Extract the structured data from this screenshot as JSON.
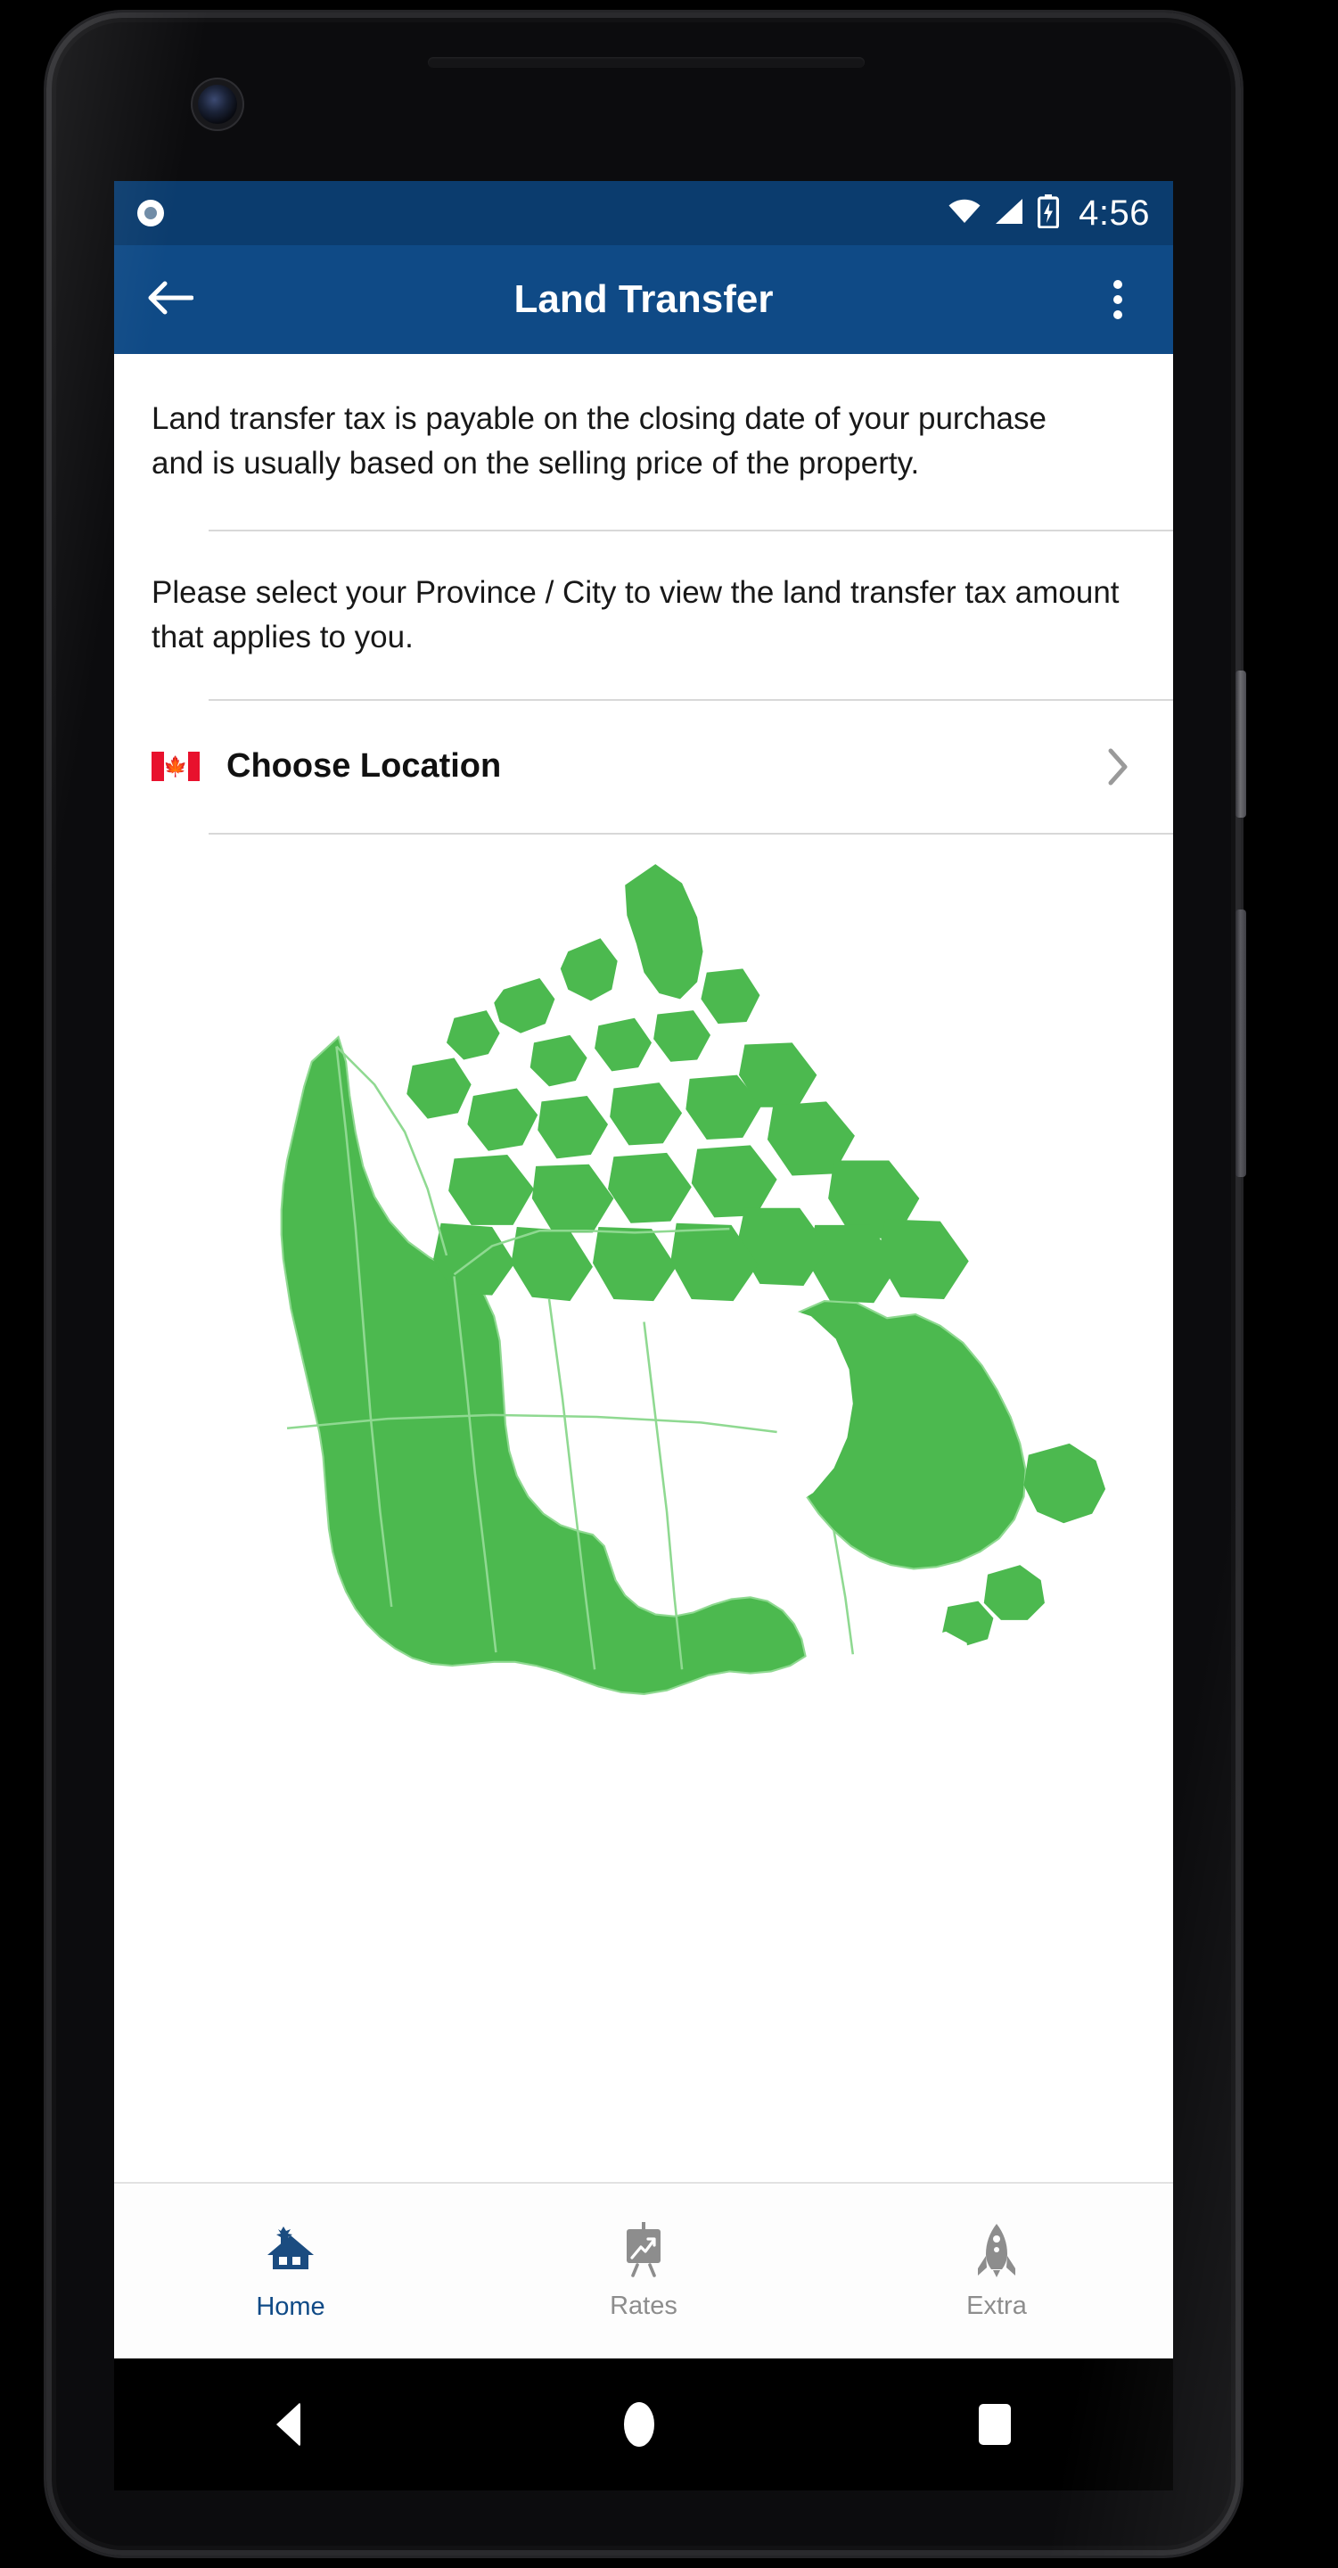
{
  "colors": {
    "brand": "#0f4a86",
    "brand_dark": "#0b3c6e",
    "map_fill": "#4cb94f",
    "map_border": "#8fd991",
    "flag_red": "#e8112d",
    "inactive_gray": "#8d8d8d"
  },
  "status_bar": {
    "notification_icon": "record-circle-icon",
    "wifi_icon": "wifi-icon",
    "signal_icon": "cellular-signal-icon",
    "battery_icon": "battery-charging-icon",
    "clock": "4:56"
  },
  "app_bar": {
    "back_icon": "arrow-left-icon",
    "title": "Land Transfer",
    "overflow_icon": "more-vertical-icon"
  },
  "content": {
    "intro_paragraph": "Land transfer tax is payable on the closing date of your purchase and is usually based on the selling price of the property.",
    "select_paragraph": "Please select your Province / City to view the land transfer tax amount that applies to you.",
    "choose_location": {
      "flag_icon": "canada-flag-icon",
      "label": "Choose Location",
      "chevron_icon": "chevron-right-icon"
    },
    "map": {
      "name": "canada-map-image",
      "alt": "Map of Canada with provincial borders"
    }
  },
  "bottom_nav": {
    "items": [
      {
        "label": "Home",
        "icon": "house-maple-leaf-icon",
        "active": true
      },
      {
        "label": "Rates",
        "icon": "chart-easel-icon",
        "active": false
      },
      {
        "label": "Extra",
        "icon": "rocket-icon",
        "active": false
      }
    ]
  },
  "system_nav": {
    "back_icon": "triangle-back-icon",
    "home_icon": "circle-home-icon",
    "recents_icon": "square-recents-icon"
  }
}
